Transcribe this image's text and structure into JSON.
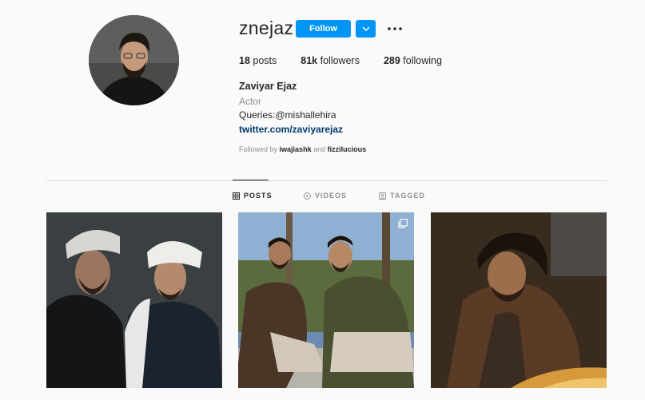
{
  "profile": {
    "username": "znejaz",
    "follow_label": "Follow",
    "full_name": "Zaviyar Ejaz",
    "category": "Actor",
    "bio": "Queries:@mishallehira",
    "website": "twitter.com/zaviyarejaz",
    "followed_by_prefix": "Followed by",
    "followed_by_user1": "iwajiashk",
    "followed_by_and": "and",
    "followed_by_user2": "fizzilucious"
  },
  "stats": {
    "posts_count": "18",
    "posts_label": "posts",
    "followers_count": "81k",
    "followers_label": "followers",
    "following_count": "289",
    "following_label": "following"
  },
  "tabs": [
    {
      "label": "POSTS",
      "icon": "grid-icon",
      "active": true
    },
    {
      "label": "VIDEOS",
      "icon": "play-icon",
      "active": false
    },
    {
      "label": "TAGGED",
      "icon": "tag-icon",
      "active": false
    }
  ],
  "posts": [
    {
      "icon": "photo",
      "multi": false
    },
    {
      "icon": "photo",
      "multi": true
    },
    {
      "icon": "photo",
      "multi": false
    }
  ],
  "colors": {
    "accent": "#0095f6",
    "background": "#fafafa",
    "text": "#262626",
    "muted": "#8e8e8e",
    "link": "#00376b"
  }
}
